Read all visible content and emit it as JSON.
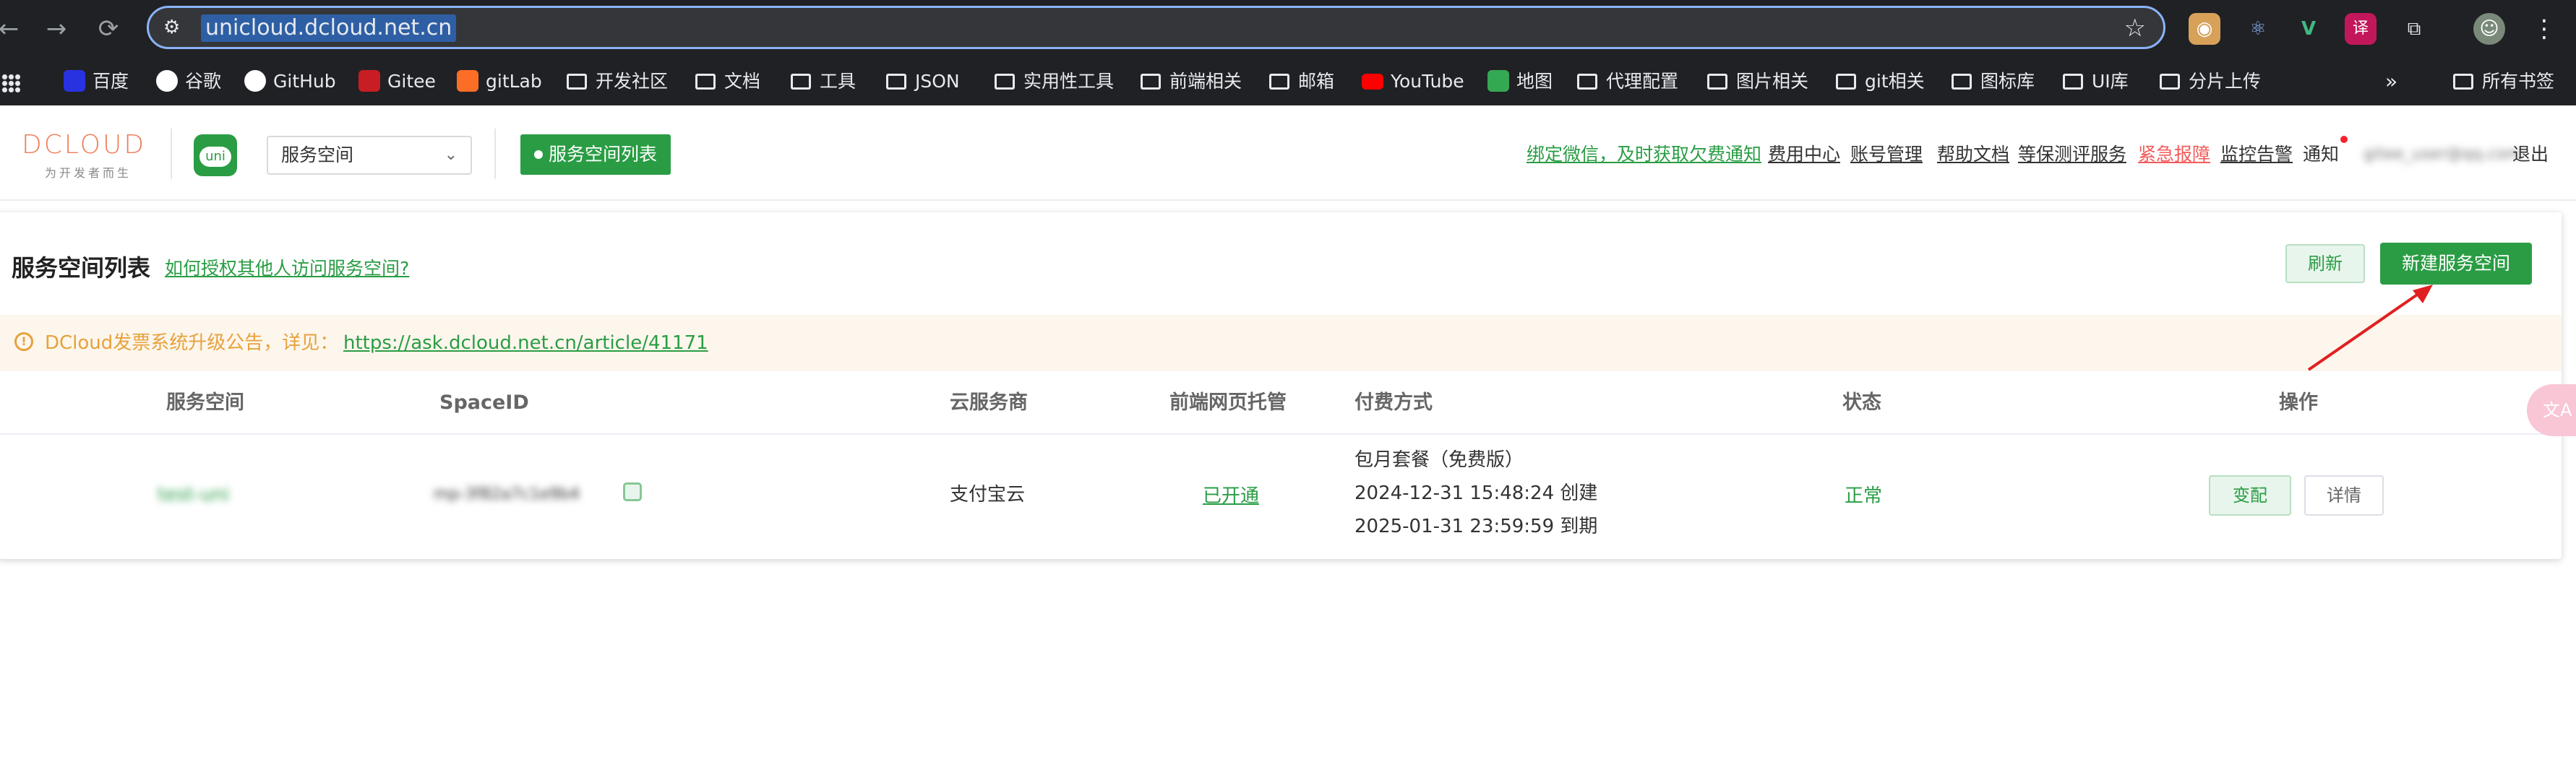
{
  "browser": {
    "url": "unicloud.dcloud.net.cn",
    "bookmarks": [
      {
        "label": "百度",
        "icon": "baidu-icon",
        "color": "#2932e1"
      },
      {
        "label": "谷歌",
        "icon": "google-icon",
        "color": "#ffffff"
      },
      {
        "label": "GitHub",
        "icon": "github-icon",
        "color": "#ffffff"
      },
      {
        "label": "Gitee",
        "icon": "gitee-icon",
        "color": "#c71d23"
      },
      {
        "label": "gitLab",
        "icon": "gitlab-icon",
        "color": "#fc6d26"
      },
      {
        "label": "开发社区",
        "icon": "folder-icon"
      },
      {
        "label": "文档",
        "icon": "folder-icon"
      },
      {
        "label": "工具",
        "icon": "folder-icon"
      },
      {
        "label": "JSON",
        "icon": "folder-icon"
      },
      {
        "label": "实用性工具",
        "icon": "folder-icon"
      },
      {
        "label": "前端相关",
        "icon": "folder-icon"
      },
      {
        "label": "邮箱",
        "icon": "folder-icon"
      },
      {
        "label": "YouTube",
        "icon": "youtube-icon",
        "color": "#ff0000"
      },
      {
        "label": "地图",
        "icon": "maps-icon",
        "color": "#34a853"
      },
      {
        "label": "代理配置",
        "icon": "folder-icon"
      },
      {
        "label": "图片相关",
        "icon": "folder-icon"
      },
      {
        "label": "git相关",
        "icon": "folder-icon"
      },
      {
        "label": "图标库",
        "icon": "folder-icon"
      },
      {
        "label": "UI库",
        "icon": "folder-icon"
      },
      {
        "label": "分片上传",
        "icon": "folder-icon"
      }
    ],
    "more": "»",
    "all_bookmarks": "所有书签"
  },
  "header": {
    "logo": "DCLOUD",
    "logo_sub": "为开发者而生",
    "uni_logo": "uni",
    "select_value": "服务空间",
    "space_list_button": "服务空间列表",
    "links": {
      "bind_wechat": "绑定微信，及时获取欠费通知",
      "fee_center": "费用中心",
      "account": "账号管理",
      "help_docs": "帮助文档",
      "security_eval": "等保测评服务",
      "emergency": "紧急报障",
      "monitor": "监控告警",
      "notify": "通知",
      "user": "gitee_user@qq.com",
      "logout": "退出"
    }
  },
  "card": {
    "title": "服务空间列表",
    "help_link": "如何授权其他人访问服务空间?",
    "refresh": "刷新",
    "new_space": "新建服务空间",
    "notice_text": "DCloud发票系统升级公告，详见：",
    "notice_link": "https://ask.dcloud.net.cn/article/41171",
    "columns": [
      "服务空间",
      "SpaceID",
      "云服务商",
      "前端网页托管",
      "付费方式",
      "状态",
      "操作"
    ],
    "row": {
      "space_name": "test-uni",
      "space_id": "mp-3f82a7c1e9b4",
      "provider": "支付宝云",
      "hosting": "已开通",
      "plan": "包月套餐（免费版）",
      "created": "2024-12-31 15:48:24 创建",
      "expires": "2025-01-31 23:59:59 到期",
      "status": "正常",
      "change": "变配",
      "detail": "详情"
    }
  },
  "colors": {
    "accent": "#2a9d44",
    "warning": "#e6a23c",
    "danger": "#f25c5c"
  }
}
